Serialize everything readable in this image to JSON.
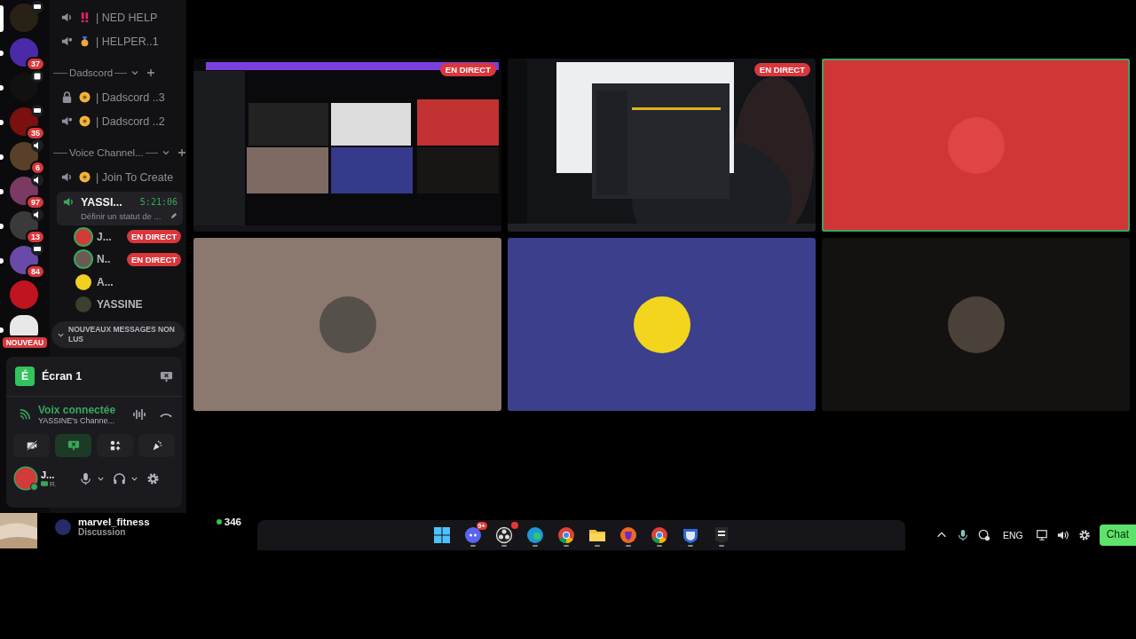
{
  "servers": [
    {
      "kind": "screen",
      "color": "#2a2116",
      "selected": true
    },
    {
      "kind": "plain",
      "color": "#4b2aa8",
      "selected": false,
      "unread": true,
      "badge": "37"
    },
    {
      "kind": "event",
      "color": "#111111",
      "selected": false,
      "unread": true
    },
    {
      "kind": "screen",
      "color": "#7a1010",
      "selected": false,
      "unread": true,
      "badge": "35"
    },
    {
      "kind": "voice",
      "color": "#5a4028",
      "selected": false,
      "unread": true,
      "badge": "6"
    },
    {
      "kind": "voice",
      "color": "#7a3a62",
      "selected": false,
      "unread": true,
      "badge": "97"
    },
    {
      "kind": "voice",
      "color": "#3a3a3a",
      "selected": false,
      "unread": true,
      "badge": "13"
    },
    {
      "kind": "screen",
      "color": "#6a4aa8",
      "selected": false,
      "unread": true,
      "badge": "84"
    },
    {
      "kind": "plain",
      "color": "#c0141e",
      "selected": false,
      "unread": false
    },
    {
      "kind": "plain",
      "color": "#e8e8e8",
      "selected": false,
      "unread": true,
      "badge": "NOUVEAU"
    }
  ],
  "channels": [
    {
      "kind": "voice",
      "name": "| NED HELP"
    },
    {
      "kind": "stage",
      "name": "| HELPER..1"
    },
    {
      "kind": "category",
      "name": "Dadscord"
    },
    {
      "kind": "locked",
      "name": "| Dadscord ..3"
    },
    {
      "kind": "stage",
      "name": "| Dadscord ..2"
    },
    {
      "kind": "category",
      "name": "Voice Channel..."
    },
    {
      "kind": "voice",
      "name": "| Join To Create"
    }
  ],
  "active_channel": {
    "name": "YASSI...",
    "time": "5:21:06",
    "status": "Définir un statut de ..."
  },
  "members": [
    {
      "name": "J...",
      "live": true,
      "live_label": "EN DIRECT",
      "color": "#d33a3a"
    },
    {
      "name": "N..",
      "live": true,
      "live_label": "EN DIRECT",
      "color": "#6a5a52"
    },
    {
      "name": "A...",
      "live": false,
      "color": "#f0d020"
    },
    {
      "name": "YASSINE",
      "live": false,
      "color": "#3a4030"
    }
  ],
  "unread_pill": "NOUVEAUX MESSAGES NON LUS",
  "panel": {
    "screen_letter": "É",
    "screen_name": "Écran 1",
    "voice_status": "Voix connectée",
    "voice_channel": "YASSINE's Channe...",
    "actions": [
      {
        "kind": "camera",
        "on": false
      },
      {
        "kind": "screen",
        "on": true
      },
      {
        "kind": "activities",
        "on": false
      },
      {
        "kind": "soundboard",
        "on": false
      }
    ],
    "user": {
      "name": "J...",
      "activity": "R."
    }
  },
  "tiles": [
    {
      "kind": "stream",
      "live_label": "EN DIRECT",
      "speaking": false
    },
    {
      "kind": "stream",
      "live_label": "EN DIRECT",
      "speaking": false
    },
    {
      "kind": "avatar",
      "color": "#d03636",
      "speaking": true
    },
    {
      "kind": "avatar",
      "color": "#8b786f",
      "speaking": false
    },
    {
      "kind": "avatar",
      "color": "#3b3f8c",
      "speaking": false
    },
    {
      "kind": "avatar",
      "color": "#141210",
      "speaking": false
    }
  ],
  "stream_card": {
    "name": "marvel_fitness",
    "status": "Discussion",
    "viewers": "346"
  },
  "taskbar": {
    "apps": [
      {
        "kind": "windows",
        "alert": false
      },
      {
        "kind": "discord",
        "alert": true,
        "badge": "9+"
      },
      {
        "kind": "obs",
        "alert": true
      },
      {
        "kind": "edge",
        "alert": false
      },
      {
        "kind": "chrome",
        "alert": false
      },
      {
        "kind": "folder",
        "alert": false
      },
      {
        "kind": "brave",
        "alert": false
      },
      {
        "kind": "chrome",
        "alert": false
      },
      {
        "kind": "rocket",
        "alert": false
      },
      {
        "kind": "epic",
        "alert": false
      }
    ],
    "language": "ENG",
    "chat_button": "Chat"
  }
}
